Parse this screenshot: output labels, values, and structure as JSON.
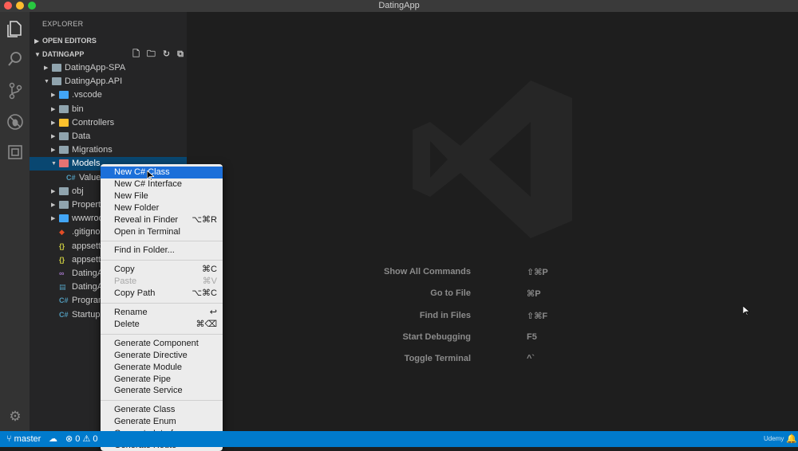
{
  "window": {
    "title": "DatingApp",
    "lights": {
      "close": "#ff5f57",
      "minimize": "#febc2e",
      "maximize": "#28c840"
    }
  },
  "activity_bar": {
    "icons": [
      "files-icon",
      "search-icon",
      "source-control-icon",
      "debug-icon",
      "extensions-icon",
      "settings-gear-icon"
    ]
  },
  "sidebar": {
    "title": "EXPLORER",
    "open_editors": "OPEN EDITORS",
    "project": "DATINGAPP",
    "tree": [
      {
        "label": "DatingApp-SPA",
        "icon": "folder",
        "depth": 1,
        "twisty": "▶"
      },
      {
        "label": "DatingApp.API",
        "icon": "folder",
        "depth": 1,
        "twisty": "▼"
      },
      {
        "label": ".vscode",
        "icon": "folder-blue",
        "depth": 2,
        "twisty": "▶"
      },
      {
        "label": "bin",
        "icon": "folder",
        "depth": 2,
        "twisty": "▶"
      },
      {
        "label": "Controllers",
        "icon": "folder-yellow",
        "depth": 2,
        "twisty": "▶"
      },
      {
        "label": "Data",
        "icon": "folder",
        "depth": 2,
        "twisty": "▶"
      },
      {
        "label": "Migrations",
        "icon": "folder",
        "depth": 2,
        "twisty": "▶"
      },
      {
        "label": "Models",
        "icon": "folder-red",
        "depth": 2,
        "twisty": "▼"
      },
      {
        "label": "Value",
        "icon": "csharp",
        "depth": 3,
        "twisty": ""
      },
      {
        "label": "obj",
        "icon": "folder",
        "depth": 2,
        "twisty": "▶"
      },
      {
        "label": "Propert",
        "icon": "folder",
        "depth": 2,
        "twisty": "▶"
      },
      {
        "label": "wwwroo",
        "icon": "folder-blue",
        "depth": 2,
        "twisty": "▶"
      },
      {
        "label": ".gitigno",
        "icon": "git",
        "depth": 2,
        "twisty": ""
      },
      {
        "label": "appsett",
        "icon": "json",
        "depth": 2,
        "twisty": ""
      },
      {
        "label": "appsett",
        "icon": "json",
        "depth": 2,
        "twisty": ""
      },
      {
        "label": "DatingA",
        "icon": "vs",
        "depth": 2,
        "twisty": ""
      },
      {
        "label": "DatingA",
        "icon": "file",
        "depth": 2,
        "twisty": ""
      },
      {
        "label": "Program",
        "icon": "csharp",
        "depth": 2,
        "twisty": ""
      },
      {
        "label": "Startup",
        "icon": "csharp",
        "depth": 2,
        "twisty": ""
      }
    ]
  },
  "context_menu": {
    "groups": [
      [
        {
          "label": "New C# Class",
          "shortcut": "",
          "highlighted": true
        },
        {
          "label": "New C# Interface",
          "shortcut": ""
        },
        {
          "label": "New File",
          "shortcut": ""
        },
        {
          "label": "New Folder",
          "shortcut": ""
        },
        {
          "label": "Reveal in Finder",
          "shortcut": "⌥⌘R"
        },
        {
          "label": "Open in Terminal",
          "shortcut": ""
        }
      ],
      [
        {
          "label": "Find in Folder...",
          "shortcut": ""
        }
      ],
      [
        {
          "label": "Copy",
          "shortcut": "⌘C"
        },
        {
          "label": "Paste",
          "shortcut": "⌘V",
          "disabled": true
        },
        {
          "label": "Copy Path",
          "shortcut": "⌥⌘C"
        }
      ],
      [
        {
          "label": "Rename",
          "shortcut": "↩"
        },
        {
          "label": "Delete",
          "shortcut": "⌘⌫"
        }
      ],
      [
        {
          "label": "Generate Component",
          "shortcut": ""
        },
        {
          "label": "Generate Directive",
          "shortcut": ""
        },
        {
          "label": "Generate Module",
          "shortcut": ""
        },
        {
          "label": "Generate Pipe",
          "shortcut": ""
        },
        {
          "label": "Generate Service",
          "shortcut": ""
        }
      ],
      [
        {
          "label": "Generate Class",
          "shortcut": ""
        },
        {
          "label": "Generate Enum",
          "shortcut": ""
        },
        {
          "label": "Generate Interface",
          "shortcut": ""
        },
        {
          "label": "Generate Route",
          "shortcut": ""
        }
      ]
    ]
  },
  "editor": {
    "shortcuts": [
      {
        "label": "Show All Commands",
        "keys": "⇧⌘P"
      },
      {
        "label": "Go to File",
        "keys": "⌘P"
      },
      {
        "label": "Find in Files",
        "keys": "⇧⌘F"
      },
      {
        "label": "Start Debugging",
        "keys": "F5"
      },
      {
        "label": "Toggle Terminal",
        "keys": "^`"
      }
    ]
  },
  "statusbar": {
    "branch": "master",
    "errors": "0",
    "warnings": "0",
    "right_text": "Udemy"
  },
  "colors": {
    "statusbar": "#007acc",
    "menu_highlight": "#1c6fd9",
    "selected_row": "#094771"
  }
}
